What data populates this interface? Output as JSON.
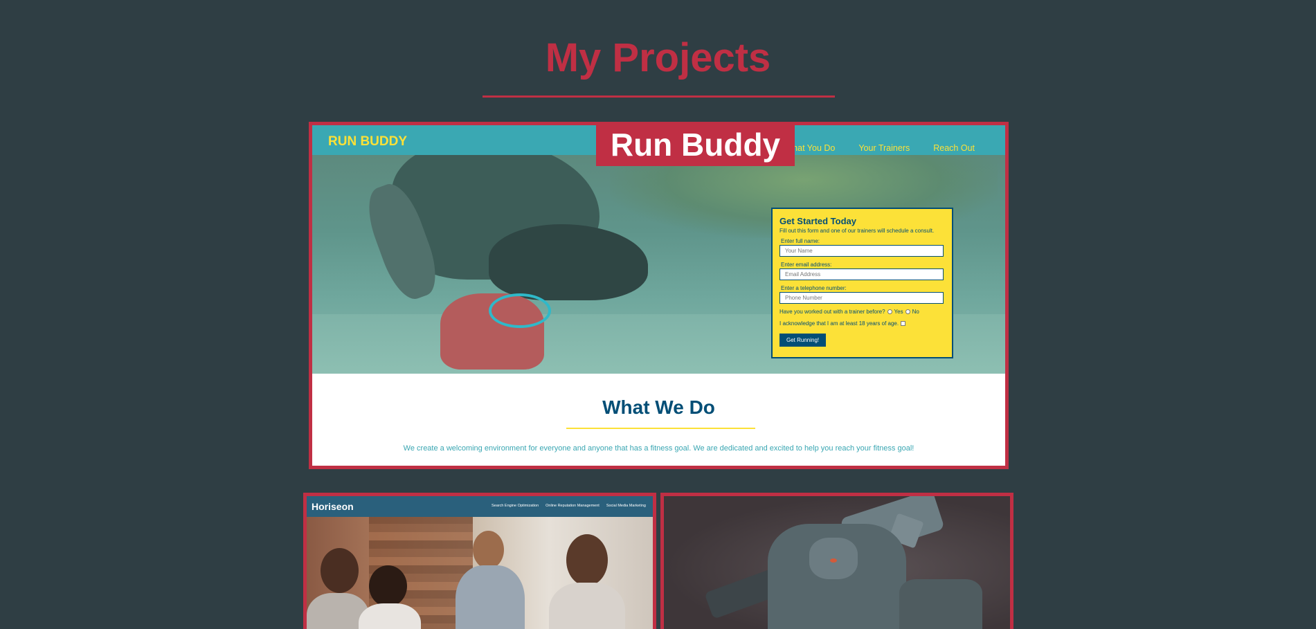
{
  "page": {
    "title": "My Projects"
  },
  "featured": {
    "label": "Run Buddy",
    "site": {
      "logo": "RUN BUDDY",
      "nav": [
        "What You Do",
        "Your Trainers",
        "Reach Out"
      ],
      "form": {
        "title": "Get Started Today",
        "subtitle": "Fill out this form and one of our trainers will schedule a consult.",
        "name_label": "Enter full name:",
        "name_placeholder": "Your Name",
        "email_label": "Enter email address:",
        "email_placeholder": "Email Address",
        "phone_label": "Enter a telephone number:",
        "phone_placeholder": "Phone Number",
        "trainer_question": "Have you worked out with a trainer before?",
        "yes": "Yes",
        "no": "No",
        "age_ack": "I acknowledge that I am at least 18 years of age.",
        "submit": "Get Running!"
      },
      "section_title": "What We Do",
      "section_text": "We create a welcoming environment for everyone and anyone that has a fitness goal. We are dedicated and excited to help you reach your fitness goal!"
    }
  },
  "projects": [
    {
      "site": {
        "logo": "Horiseon",
        "nav": [
          "Search Engine Optimization",
          "Online Reputation Management",
          "Social Media Marketing"
        ]
      }
    },
    {}
  ],
  "colors": {
    "background": "#2f3e44",
    "accent": "#c02f44",
    "runbuddy_teal": "#3aa8b3",
    "runbuddy_yellow": "#fce138",
    "runbuddy_blue": "#024e76"
  }
}
